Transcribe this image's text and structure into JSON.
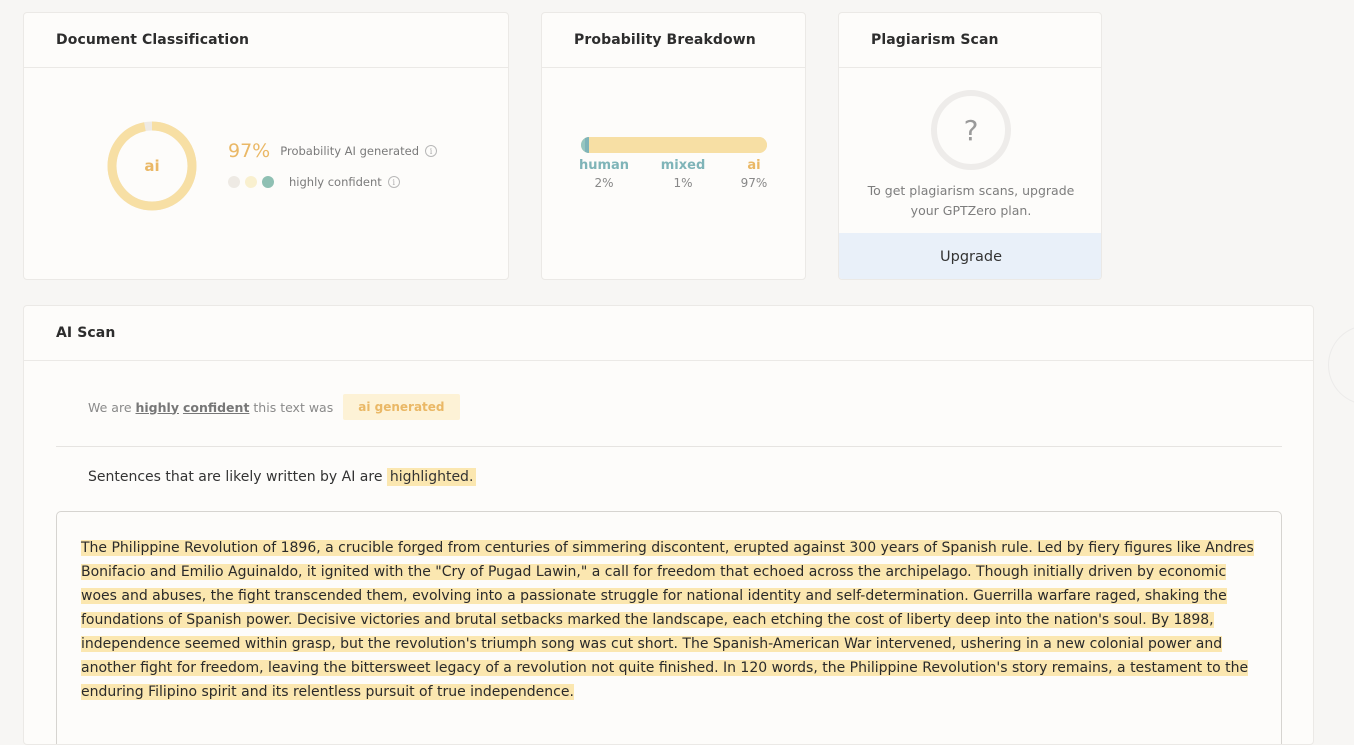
{
  "doc_classification": {
    "title": "Document Classification",
    "donut_label": "ai",
    "probability_pct": "97%",
    "probability_text": "Probability AI generated",
    "confidence_text": "highly confident",
    "ai_fraction": 0.97,
    "confidence_level": 3,
    "confidence_dots": 3
  },
  "probability_breakdown": {
    "title": "Probability Breakdown",
    "segments": [
      {
        "name": "human",
        "value": "2%",
        "fraction": 0.02,
        "color": "#96c6c0"
      },
      {
        "name": "mixed",
        "value": "1%",
        "fraction": 0.01,
        "color": "#7fb4b8"
      },
      {
        "name": "ai",
        "value": "97%",
        "fraction": 0.97,
        "color": "#eab866"
      }
    ]
  },
  "plagiarism_scan": {
    "title": "Plagiarism Scan",
    "icon_glyph": "?",
    "message": "To get plagiarism scans, upgrade your GPTZero plan.",
    "upgrade_label": "Upgrade"
  },
  "ai_scan": {
    "title": "AI Scan",
    "verdict_prefix": "We are",
    "verdict_word1": "highly",
    "verdict_word2": "confident",
    "verdict_suffix": "this text was",
    "verdict_badge": "ai generated",
    "legend_prefix": "Sentences that are likely written by AI are",
    "legend_highlight": "highlighted.",
    "passage": "The Philippine Revolution of 1896, a crucible forged from centuries of simmering discontent, erupted against 300 years of Spanish rule. Led by fiery figures like Andres Bonifacio and Emilio Aguinaldo, it ignited with the \"Cry of Pugad Lawin,\" a call for freedom that echoed across the archipelago. Though initially driven by economic woes and abuses, the fight transcended them, evolving into a passionate struggle for national identity and self-determination. Guerrilla warfare raged, shaking the foundations of Spanish power. Decisive victories and brutal setbacks marked the landscape, each etching the cost of liberty deep into the nation's soul. By 1898, independence seemed within grasp, but the revolution's triumph song was cut short. The Spanish-American War intervened, ushering in a new colonial power and another fight for freedom, leaving the bittersweet legacy of a revolution not quite finished. In 120 words, the Philippine Revolution's story remains, a testament to the enduring Filipino spirit and its relentless pursuit of true independence."
  },
  "colors": {
    "ai_accent": "#eab866",
    "ai_highlight": "#fbe7b0",
    "upgrade_bg": "#e9f0f9"
  }
}
